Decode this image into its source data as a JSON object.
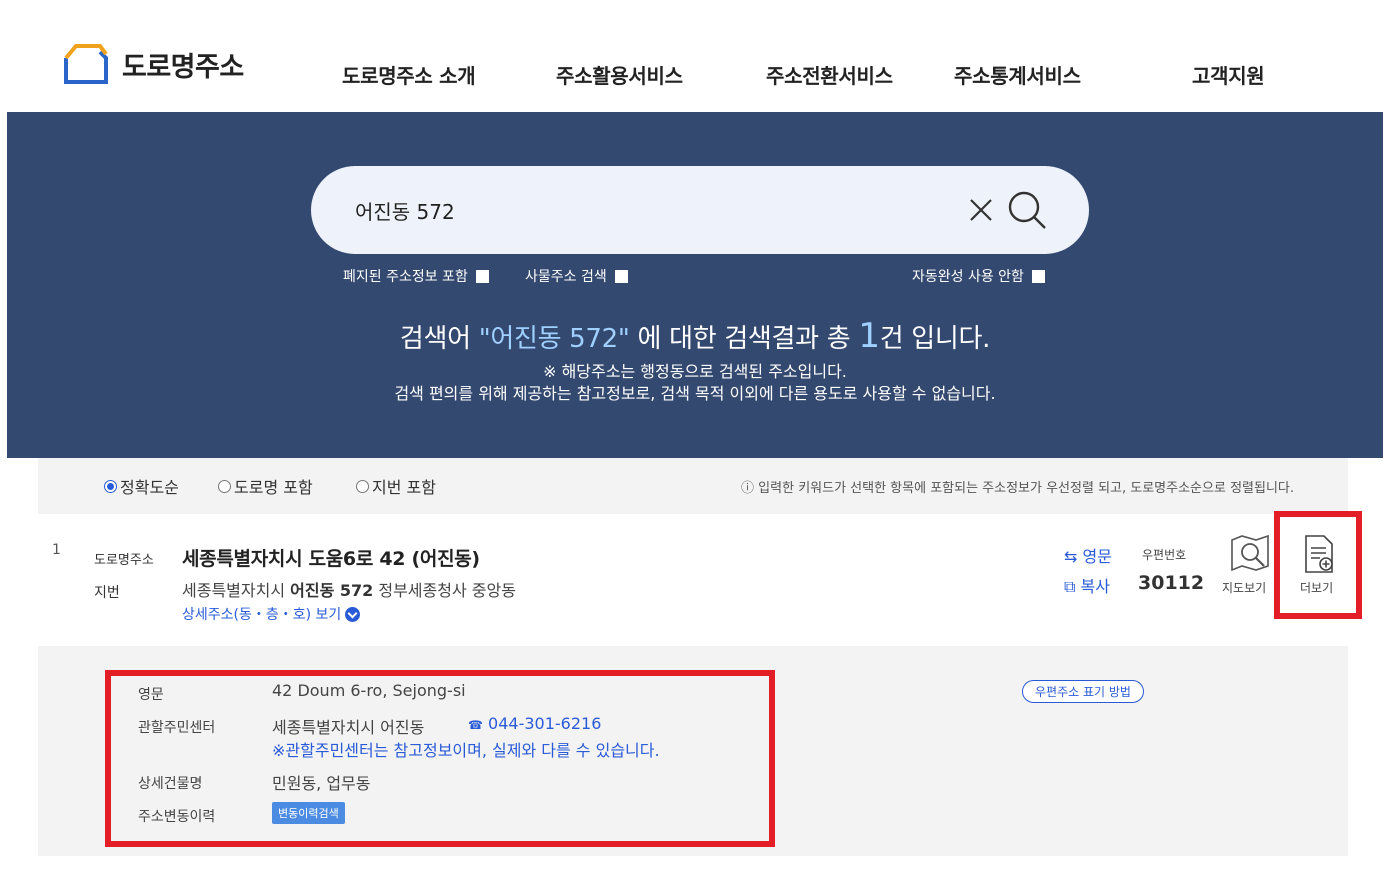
{
  "header": {
    "logo_text": "도로명주소",
    "nav": [
      "도로명주소 소개",
      "주소활용서비스",
      "주소전환서비스",
      "주소통계서비스",
      "고객지원"
    ]
  },
  "search": {
    "value": "어진동 572",
    "options": {
      "closed_address": "폐지된 주소정보 포함",
      "object_address": "사물주소 검색",
      "no_autocomplete": "자동완성 사용 안함"
    },
    "result": {
      "prefix": "검색어 ",
      "keyword": "\"어진동 572\"",
      "middle": " 에 대한 검색결과 총 ",
      "count": "1",
      "suffix": "건 입니다."
    },
    "note1": "※ 해당주소는 행정동으로 검색된 주소입니다.",
    "note2": "검색 편의를 위해 제공하는 참고정보로, 검색 목적 이외에 다른 용도로 사용할 수 없습니다."
  },
  "sort": {
    "options": [
      "정확도순",
      "도로명 포함",
      "지번 포함"
    ],
    "selected": "정확도순",
    "note": "ⓘ 입력한 키워드가 선택한 항목에 포함되는 주소정보가 우선정렬 되고, 도로명주소순으로 정렬됩니다."
  },
  "result": {
    "index": "1",
    "road_label": "도로명주소",
    "road_address": "세종특별자치시 도움6로 42 (어진동)",
    "jibun_label": "지번",
    "jibun_prefix": "세종특별자치시 ",
    "jibun_bold": "어진동 572",
    "jibun_suffix": " 정부세종청사 중앙동",
    "detail_link": "상세주소(동・층・호) 보기",
    "english_btn": "영문",
    "copy_btn": "복사",
    "zip_label": "우편번호",
    "zip_code": "30112",
    "map_label": "지도보기",
    "more_label": "더보기"
  },
  "detail": {
    "english_label": "영문",
    "english_value": "42 Doum 6-ro, Sejong-si",
    "center_label": "관할주민센터",
    "center_value": "세종특별자치시 어진동",
    "center_phone": "044-301-6216",
    "center_note": "※관할주민센터는 참고정보이며, 실제와 다를 수 있습니다.",
    "building_label": "상세건물명",
    "building_value": "민원동, 업무동",
    "history_label": "주소변동이력",
    "history_btn": "변동이력검색",
    "zip_method": "우편주소 표기 방법"
  },
  "colors": {
    "banner": "#344970",
    "accent": "#2a5bd7",
    "highlight": "#e41e26"
  }
}
